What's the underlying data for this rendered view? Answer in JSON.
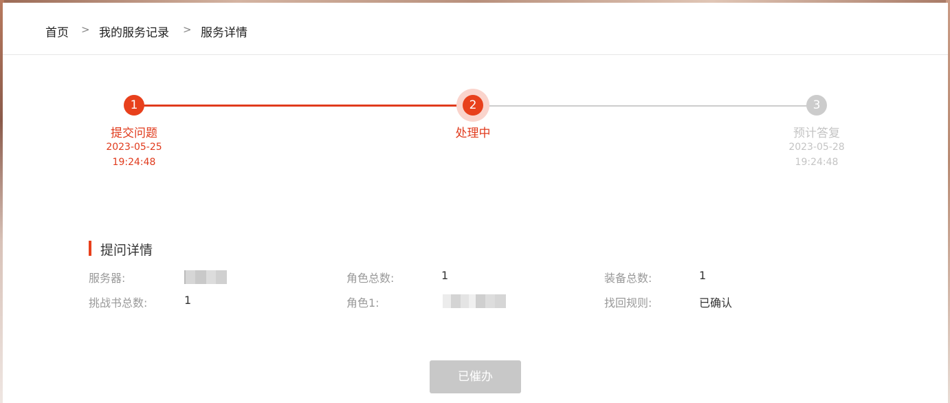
{
  "breadcrumb": {
    "home": "首页",
    "sep1": ">",
    "records": "我的服务记录",
    "sep2": ">",
    "current": "服务详情"
  },
  "progress": {
    "steps": [
      {
        "number": "1",
        "label": "提交问题",
        "date": "2023-05-25",
        "time": "19:24:48",
        "state": "done"
      },
      {
        "number": "2",
        "label": "处理中",
        "state": "current"
      },
      {
        "number": "3",
        "label": "预计答复",
        "date": "2023-05-28",
        "time": "19:24:48",
        "state": "pending"
      }
    ]
  },
  "details": {
    "title": "提问详情",
    "fields": {
      "server_label": "服务器:",
      "role_total_label": "角色总数:",
      "role_total_value": "1",
      "equip_total_label": "装备总数:",
      "equip_total_value": "1",
      "challenge_label": "挑战书总数:",
      "challenge_value": "1",
      "role1_label": "角色1:",
      "rule_label": "找回规则:",
      "rule_value": "已确认"
    }
  },
  "action": {
    "button_label": "已催办"
  },
  "colors": {
    "accent": "#e8401c",
    "inactive": "#cccccc",
    "disabled_button": "#c8c8c8"
  }
}
